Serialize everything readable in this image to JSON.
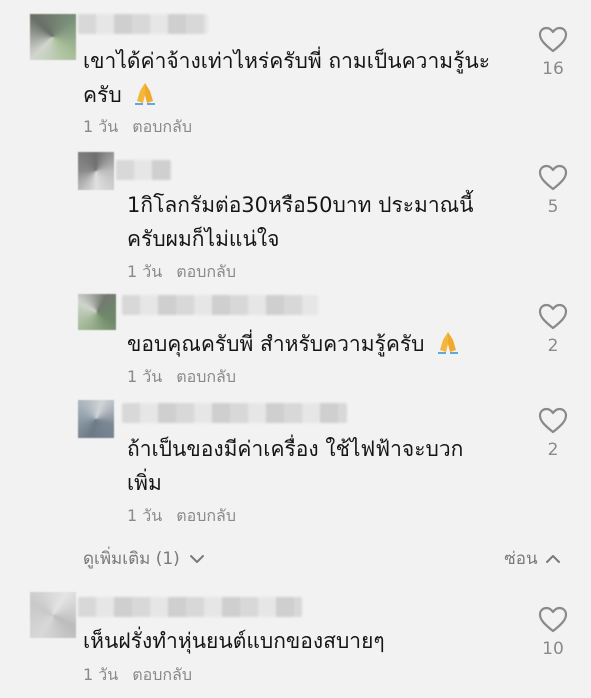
{
  "comments": [
    {
      "text_line1": "เขาได้ค่าจ้างเท่าไหร่ครับพี่ ถามเป็นความรู้นะ",
      "text_line2": "ครับ",
      "time": "1 วัน",
      "reply_label": "ตอบกลับ",
      "likes": "16"
    },
    {
      "text_line1": "1กิโลกรัมต่อ30หรือ50บาท ประมาณนี้",
      "text_line2": "ครับผมก็ไม่แน่ใจ",
      "time": "1 วัน",
      "reply_label": "ตอบกลับ",
      "likes": "5"
    },
    {
      "text_line1": "ขอบคุณครับพี่ สำหรับความรู้ครับ",
      "time": "1 วัน",
      "reply_label": "ตอบกลับ",
      "likes": "2"
    },
    {
      "text_line1": "ถ้าเป็นของมีค่าเครื่อง ใช้ไฟฟ้าจะบวก",
      "text_line2": "เพิ่ม",
      "time": "1 วัน",
      "reply_label": "ตอบกลับ",
      "likes": "2"
    },
    {
      "text_line1": "เห็นฝรั่งทำหุ่นยนต์แบกของสบายๆ",
      "time": "1 วัน",
      "reply_label": "ตอบกลับ",
      "likes": "10"
    }
  ],
  "footer": {
    "see_more": "ดูเพิ่มเติม (1)",
    "hide": "ซ่อน"
  },
  "colors": {
    "background": "#f2f2f2",
    "text": "#151515",
    "muted": "#8a8a8a"
  },
  "icons": [
    "heart-icon",
    "pray-emoji-icon",
    "chevron-down-icon",
    "chevron-up-icon"
  ]
}
